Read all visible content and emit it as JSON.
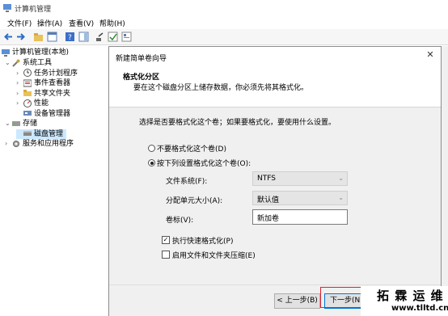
{
  "window": {
    "title": "计算机管理"
  },
  "menu": [
    "文件(F)",
    "操作(A)",
    "查看(V)",
    "帮助(H)"
  ],
  "toolbar": [
    "back-icon",
    "forward-icon",
    "folder-up-icon",
    "properties-icon",
    "help-icon",
    "show-hide-icon",
    "export-icon",
    "view-icon"
  ],
  "tree": {
    "root": "计算机管理(本地)",
    "system_tools": "系统工具",
    "items": [
      "任务计划程序",
      "事件查看器",
      "共享文件夹",
      "性能",
      "设备管理器"
    ],
    "storage": "存储",
    "disk_management": "磁盘管理",
    "services": "服务和应用程序"
  },
  "dialog": {
    "title": "新建简单卷向导",
    "close": "✕",
    "section_title": "格式化分区",
    "section_subtitle": "要在这个磁盘分区上储存数据，你必须先将其格式化。",
    "question": "选择是否要格式化这个卷；如果要格式化，要使用什么设置。",
    "radio_no_format": "不要格式化这个卷(D)",
    "radio_format": "按下列设置格式化这个卷(O):",
    "fs_label": "文件系统(F):",
    "fs_value": "NTFS",
    "alloc_label": "分配单元大小(A):",
    "alloc_value": "默认值",
    "vol_label": "卷标(V):",
    "vol_value": "新加卷",
    "quick_format": "执行快速格式化(P)",
    "compression": "启用文件和文件夹压缩(E)",
    "back_button": "< 上一步(B)",
    "next_button": "下一步(N)"
  },
  "watermark": {
    "line1": "拓 霖 运 维",
    "line2": "www.tlltd.cn"
  }
}
